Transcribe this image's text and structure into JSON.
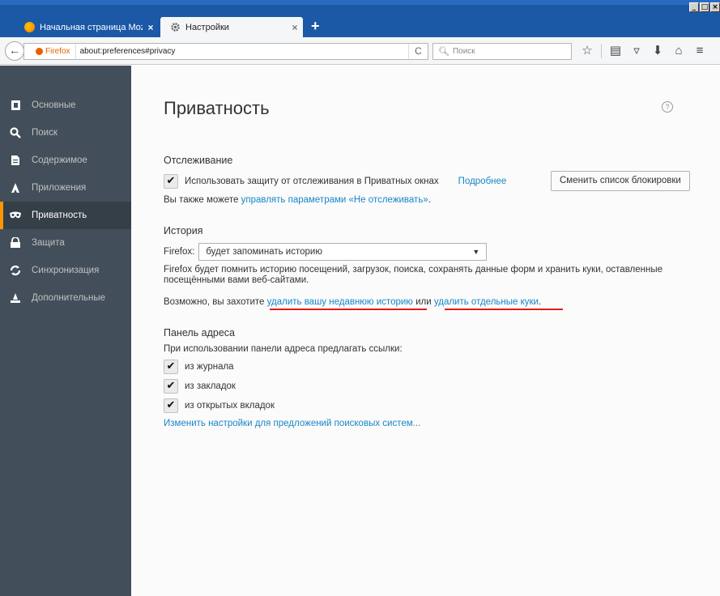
{
  "window": {
    "controls": [
      "_",
      "□",
      "×"
    ]
  },
  "tabs": [
    {
      "title": "Начальная страница Mozilla ...",
      "close": "×",
      "active": false,
      "favicon_color": "#ff9500"
    },
    {
      "title": "Настройки",
      "close": "×",
      "active": true,
      "favicon": "gear-icon"
    }
  ],
  "new_tab": "+",
  "navbar": {
    "identity": "Firefox",
    "url": "about:preferences#privacy",
    "reload": "C",
    "search_placeholder": "Поиск"
  },
  "sidebar": {
    "items": [
      {
        "label": "Основные",
        "icon": "general-icon"
      },
      {
        "label": "Поиск",
        "icon": "search-icon"
      },
      {
        "label": "Содержимое",
        "icon": "content-icon"
      },
      {
        "label": "Приложения",
        "icon": "applications-icon"
      },
      {
        "label": "Приватность",
        "icon": "privacy-mask-icon",
        "selected": true
      },
      {
        "label": "Защита",
        "icon": "security-lock-icon"
      },
      {
        "label": "Синхронизация",
        "icon": "sync-icon"
      },
      {
        "label": "Дополнительные",
        "icon": "advanced-icon"
      }
    ]
  },
  "main": {
    "title": "Приватность",
    "help": "?",
    "tracking": {
      "heading": "Отслеживание",
      "checkbox_label": "Использовать защиту от отслеживания в Приватных окнах",
      "checked": true,
      "learn_more": "Подробнее",
      "change_list_button": "Сменить список блокировки",
      "dnt_prefix": "Вы также можете ",
      "dnt_link": "управлять параметрами «Не отслеживать»",
      "dnt_suffix": "."
    },
    "history": {
      "heading": "История",
      "select_label": "Firefox:",
      "select_value": "будет запоминать историю",
      "description": "Firefox будет помнить историю посещений, загрузок, поиска, сохранять данные форм и хранить куки, оставленные посещёнными вами веб-сайтами.",
      "maybe_prefix": "Возможно, вы захотите ",
      "clear_history_link": "удалить вашу недавнюю историю",
      "or_text": " или ",
      "remove_cookies_link": "удалить отдельные куки",
      "maybe_suffix": "."
    },
    "address_bar": {
      "heading": "Панель адреса",
      "intro": "При использовании панели адреса предлагать ссылки:",
      "options": [
        {
          "label": "из журнала",
          "checked": true
        },
        {
          "label": "из закладок",
          "checked": true
        },
        {
          "label": "из открытых вкладок",
          "checked": true
        }
      ],
      "search_suggestions_link": "Изменить настройки для предложений поисковых систем..."
    }
  },
  "colors": {
    "titlebar": "#1b58a6",
    "sidebar": "#424f5a",
    "sidebar_selected_accent": "#ff9500",
    "link": "#1787c7",
    "annotation_underline": "#e51b1b"
  }
}
